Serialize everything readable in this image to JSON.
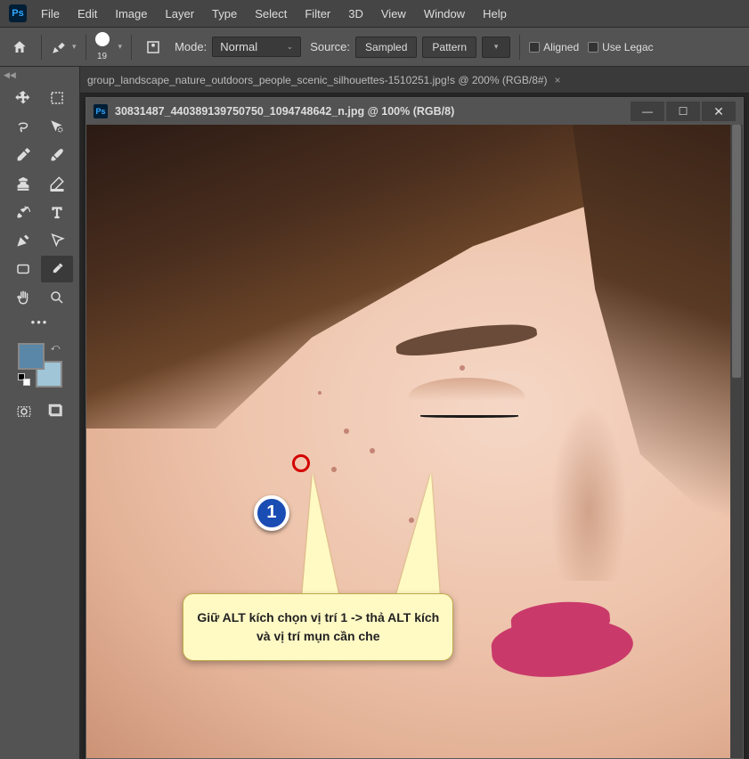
{
  "app": "Ps",
  "menu": [
    "File",
    "Edit",
    "Image",
    "Layer",
    "Type",
    "Select",
    "Filter",
    "3D",
    "View",
    "Window",
    "Help"
  ],
  "options": {
    "brush_size": "19",
    "mode_label": "Mode:",
    "mode_value": "Normal",
    "source_label": "Source:",
    "sampled": "Sampled",
    "pattern": "Pattern",
    "aligned": "Aligned",
    "use_legacy": "Use Legac"
  },
  "bg_tab": {
    "title": "group_landscape_nature_outdoors_people_scenic_silhouettes-1510251.jpg!s @ 200% (RGB/8#)",
    "close": "×"
  },
  "doc": {
    "title": "30831487_440389139750750_1094748642_n.jpg @ 100% (RGB/8)"
  },
  "anno": {
    "badge": "1",
    "callout": "Giữ ALT kích chọn vị trí 1 -> thả ALT kích và vị trí mụn cần che"
  },
  "tools": {
    "move": "move-tool",
    "marquee": "marquee-tool",
    "lasso": "lasso-tool",
    "wand": "quick-select-tool",
    "eyedrop": "eyedropper-tool",
    "brush": "brush-tool",
    "stamp": "clone-stamp-tool",
    "eraser": "eraser-tool",
    "ihistory": "history-brush-tool",
    "type": "type-tool",
    "pen": "pen-tool",
    "path": "path-select-tool",
    "shape": "rectangle-tool",
    "heal": "healing-brush-tool",
    "hand": "hand-tool",
    "zoom": "zoom-tool"
  }
}
